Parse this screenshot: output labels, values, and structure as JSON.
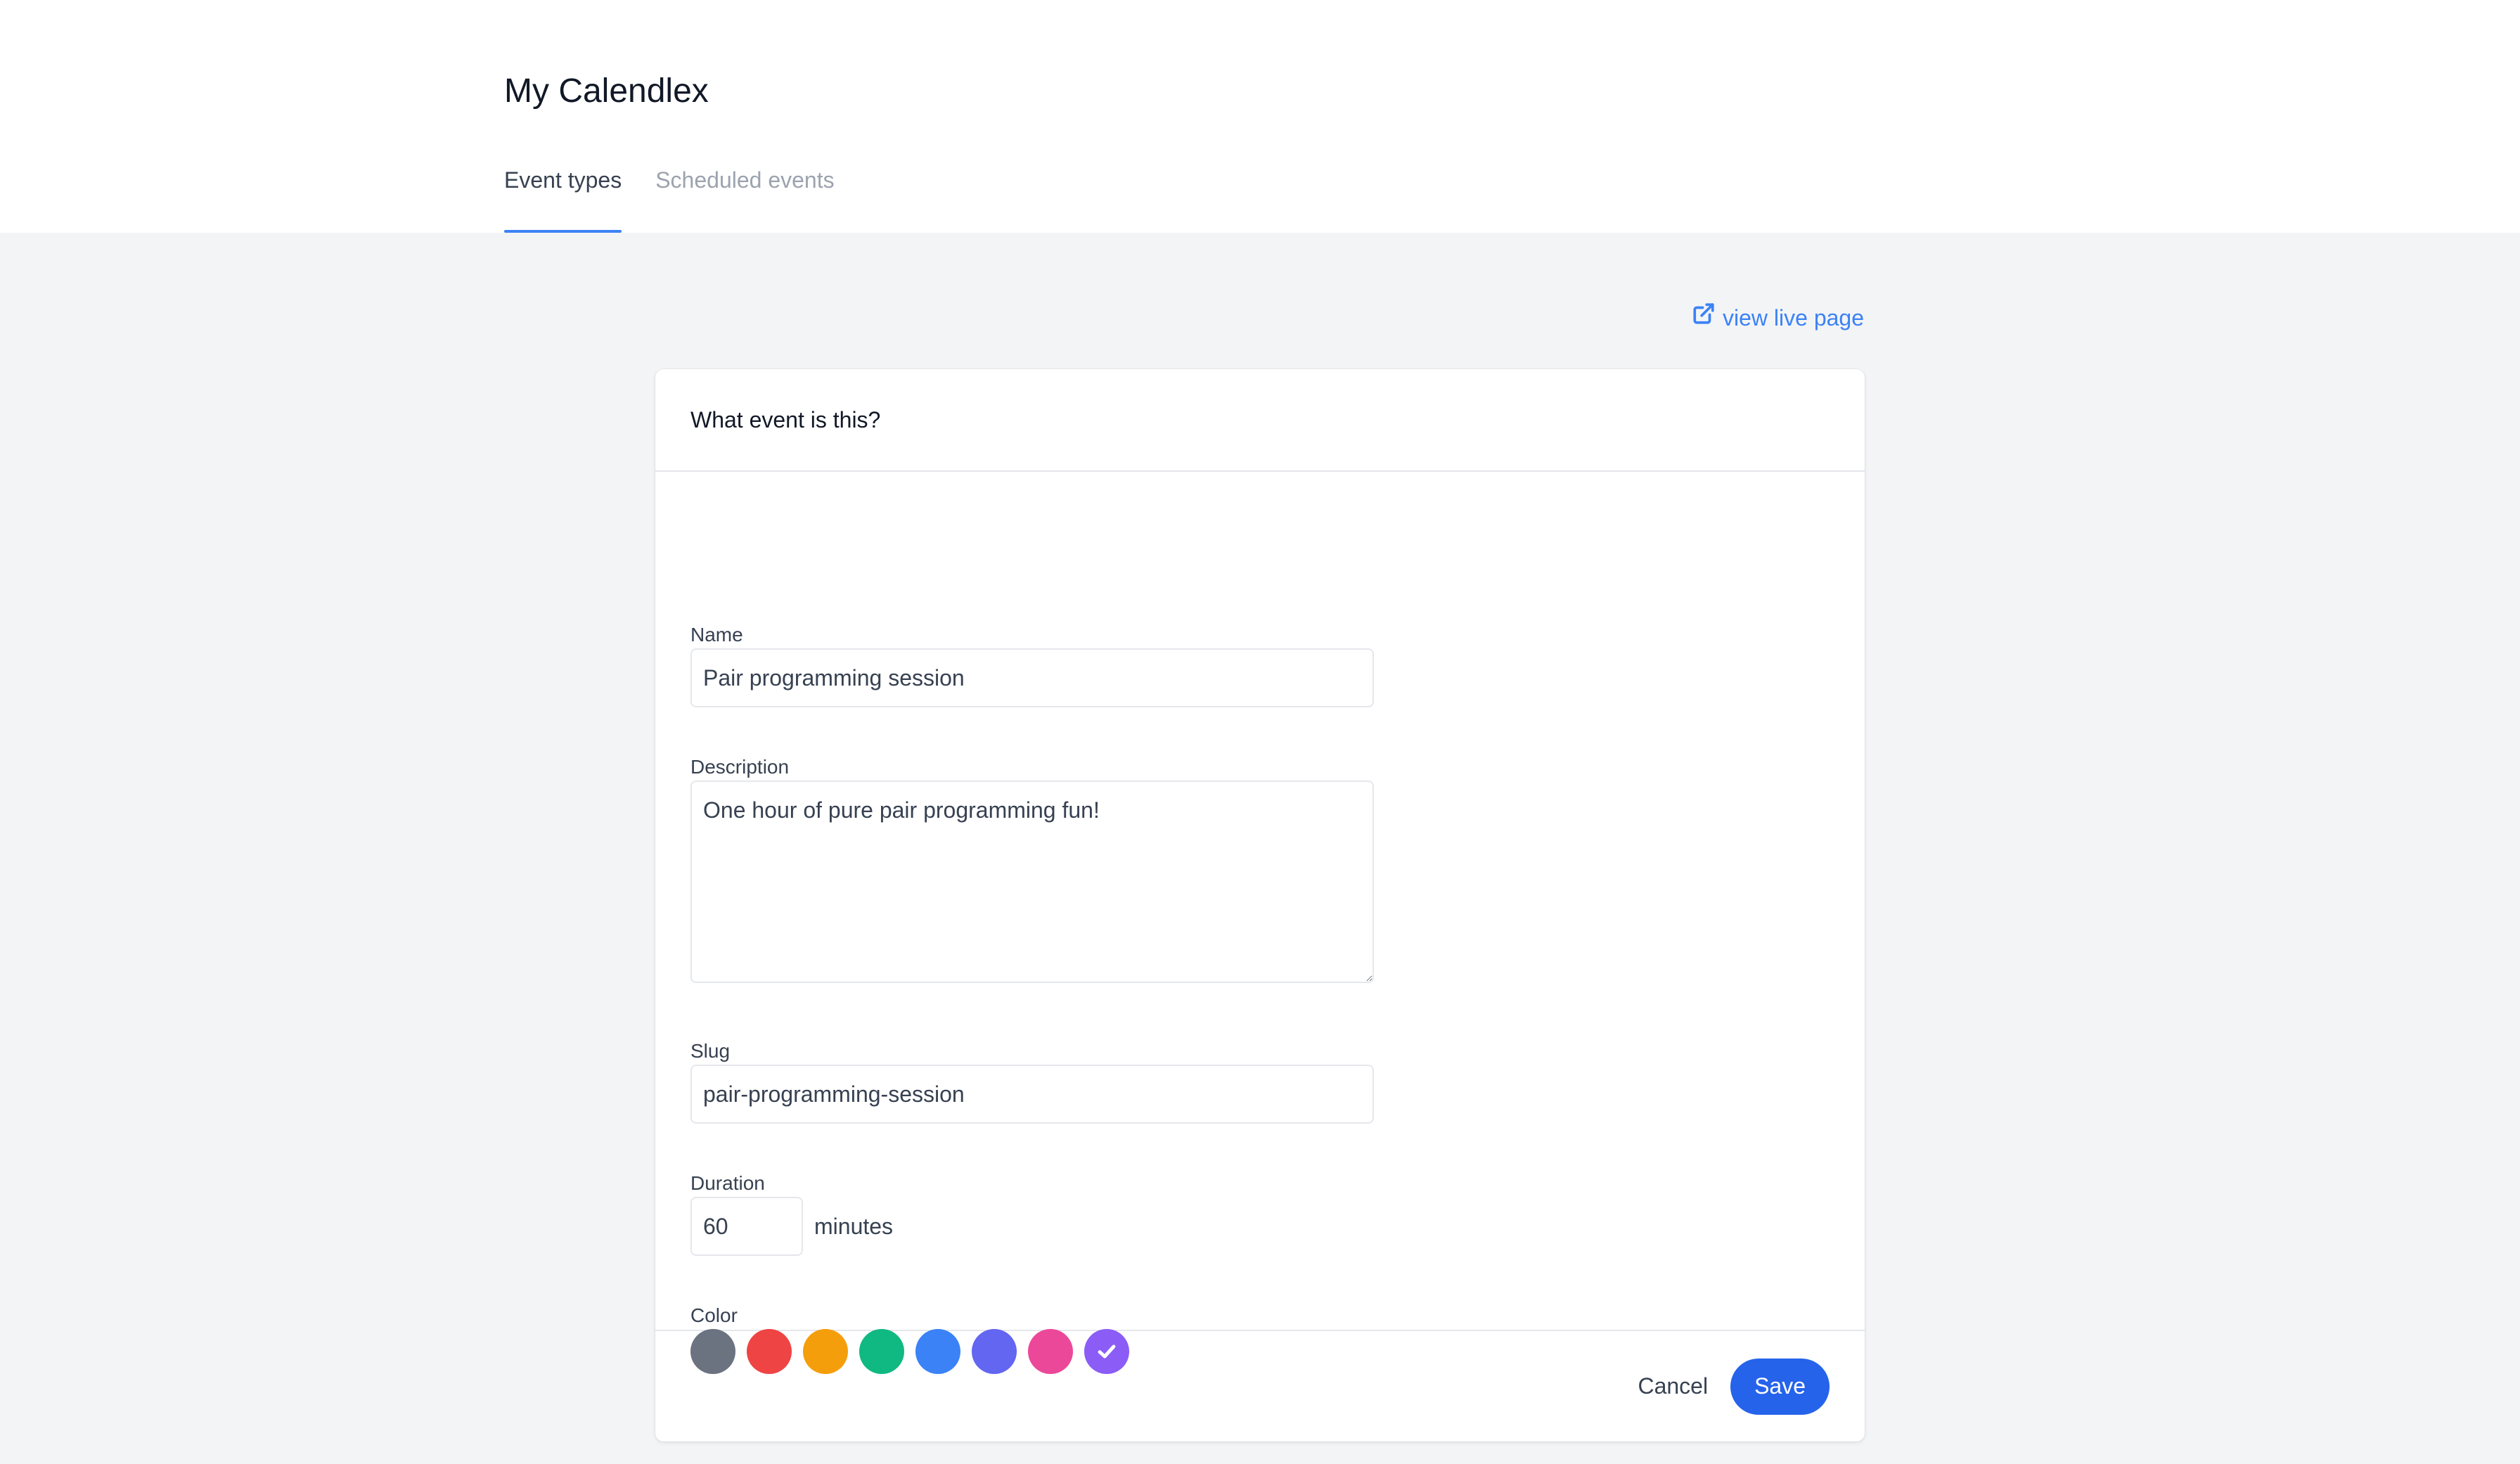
{
  "header": {
    "title": "My Calendlex",
    "tabs": [
      {
        "label": "Event types",
        "active": true
      },
      {
        "label": "Scheduled events",
        "active": false
      }
    ]
  },
  "live_link": {
    "label": "view live page",
    "icon": "external-link-icon"
  },
  "form": {
    "heading": "What event is this?",
    "name": {
      "label": "Name",
      "value": "Pair programming session"
    },
    "description": {
      "label": "Description",
      "value": "One hour of pure pair programming fun!"
    },
    "slug": {
      "label": "Slug",
      "value": "pair-programming-session"
    },
    "duration": {
      "label": "Duration",
      "value": "60",
      "unit": "minutes"
    },
    "color": {
      "label": "Color",
      "options": [
        "#6b7280",
        "#ef4444",
        "#f59e0b",
        "#10b981",
        "#3b82f6",
        "#6366f1",
        "#ec4899",
        "#8b5cf6"
      ],
      "selected": "#8b5cf6"
    },
    "cancel_label": "Cancel",
    "save_label": "Save"
  }
}
